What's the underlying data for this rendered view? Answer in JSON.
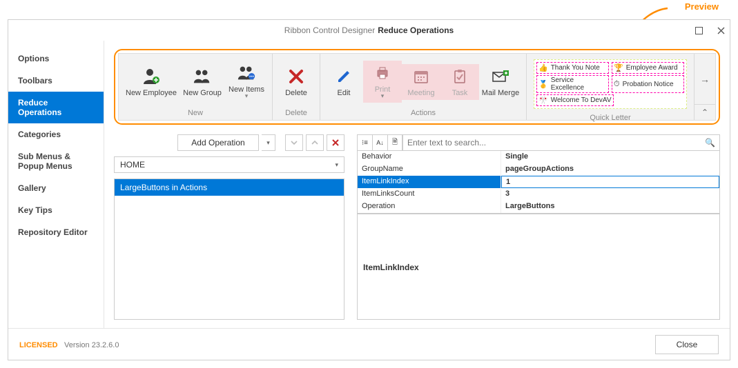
{
  "annotation": {
    "preview": "Preview"
  },
  "dialog": {
    "title_prefix": "Ribbon Control Designer",
    "title_page": "Reduce Operations"
  },
  "sidebar": {
    "items": [
      "Options",
      "Toolbars",
      "Reduce Operations",
      "Categories",
      "Sub Menus & Popup Menus",
      "Gallery",
      "Key Tips",
      "Repository Editor"
    ],
    "selected_index": 2
  },
  "ribbon": {
    "groups": [
      {
        "caption": "New",
        "items": [
          "New Employee",
          "New Group",
          "New Items"
        ]
      },
      {
        "caption": "Delete",
        "items": [
          "Delete"
        ]
      },
      {
        "caption": "Actions",
        "items": [
          "Edit",
          "Print",
          "Meeting",
          "Task",
          "Mail Merge"
        ],
        "highlighted_items": [
          "Print",
          "Meeting",
          "Task"
        ]
      },
      {
        "caption": "Quick Letter",
        "gallery": [
          "Thank You Note",
          "Employee Award",
          "Service Excellence",
          "Probation Notice",
          "Welcome To DevAV"
        ]
      }
    ]
  },
  "left_panel": {
    "add_operation": "Add Operation",
    "page_selector": "HOME",
    "operations": [
      "LargeButtons in Actions"
    ]
  },
  "property_grid": {
    "search_placeholder": "Enter text to search...",
    "rows": [
      {
        "name": "Behavior",
        "value": "Single"
      },
      {
        "name": "GroupName",
        "value": "pageGroupActions"
      },
      {
        "name": "ItemLinkIndex",
        "value": "1"
      },
      {
        "name": "ItemLinksCount",
        "value": "3"
      },
      {
        "name": "Operation",
        "value": "LargeButtons"
      }
    ],
    "selected_row_index": 2,
    "description": "ItemLinkIndex"
  },
  "footer": {
    "license": "LICENSED",
    "version": "Version 23.2.6.0",
    "close": "Close"
  }
}
